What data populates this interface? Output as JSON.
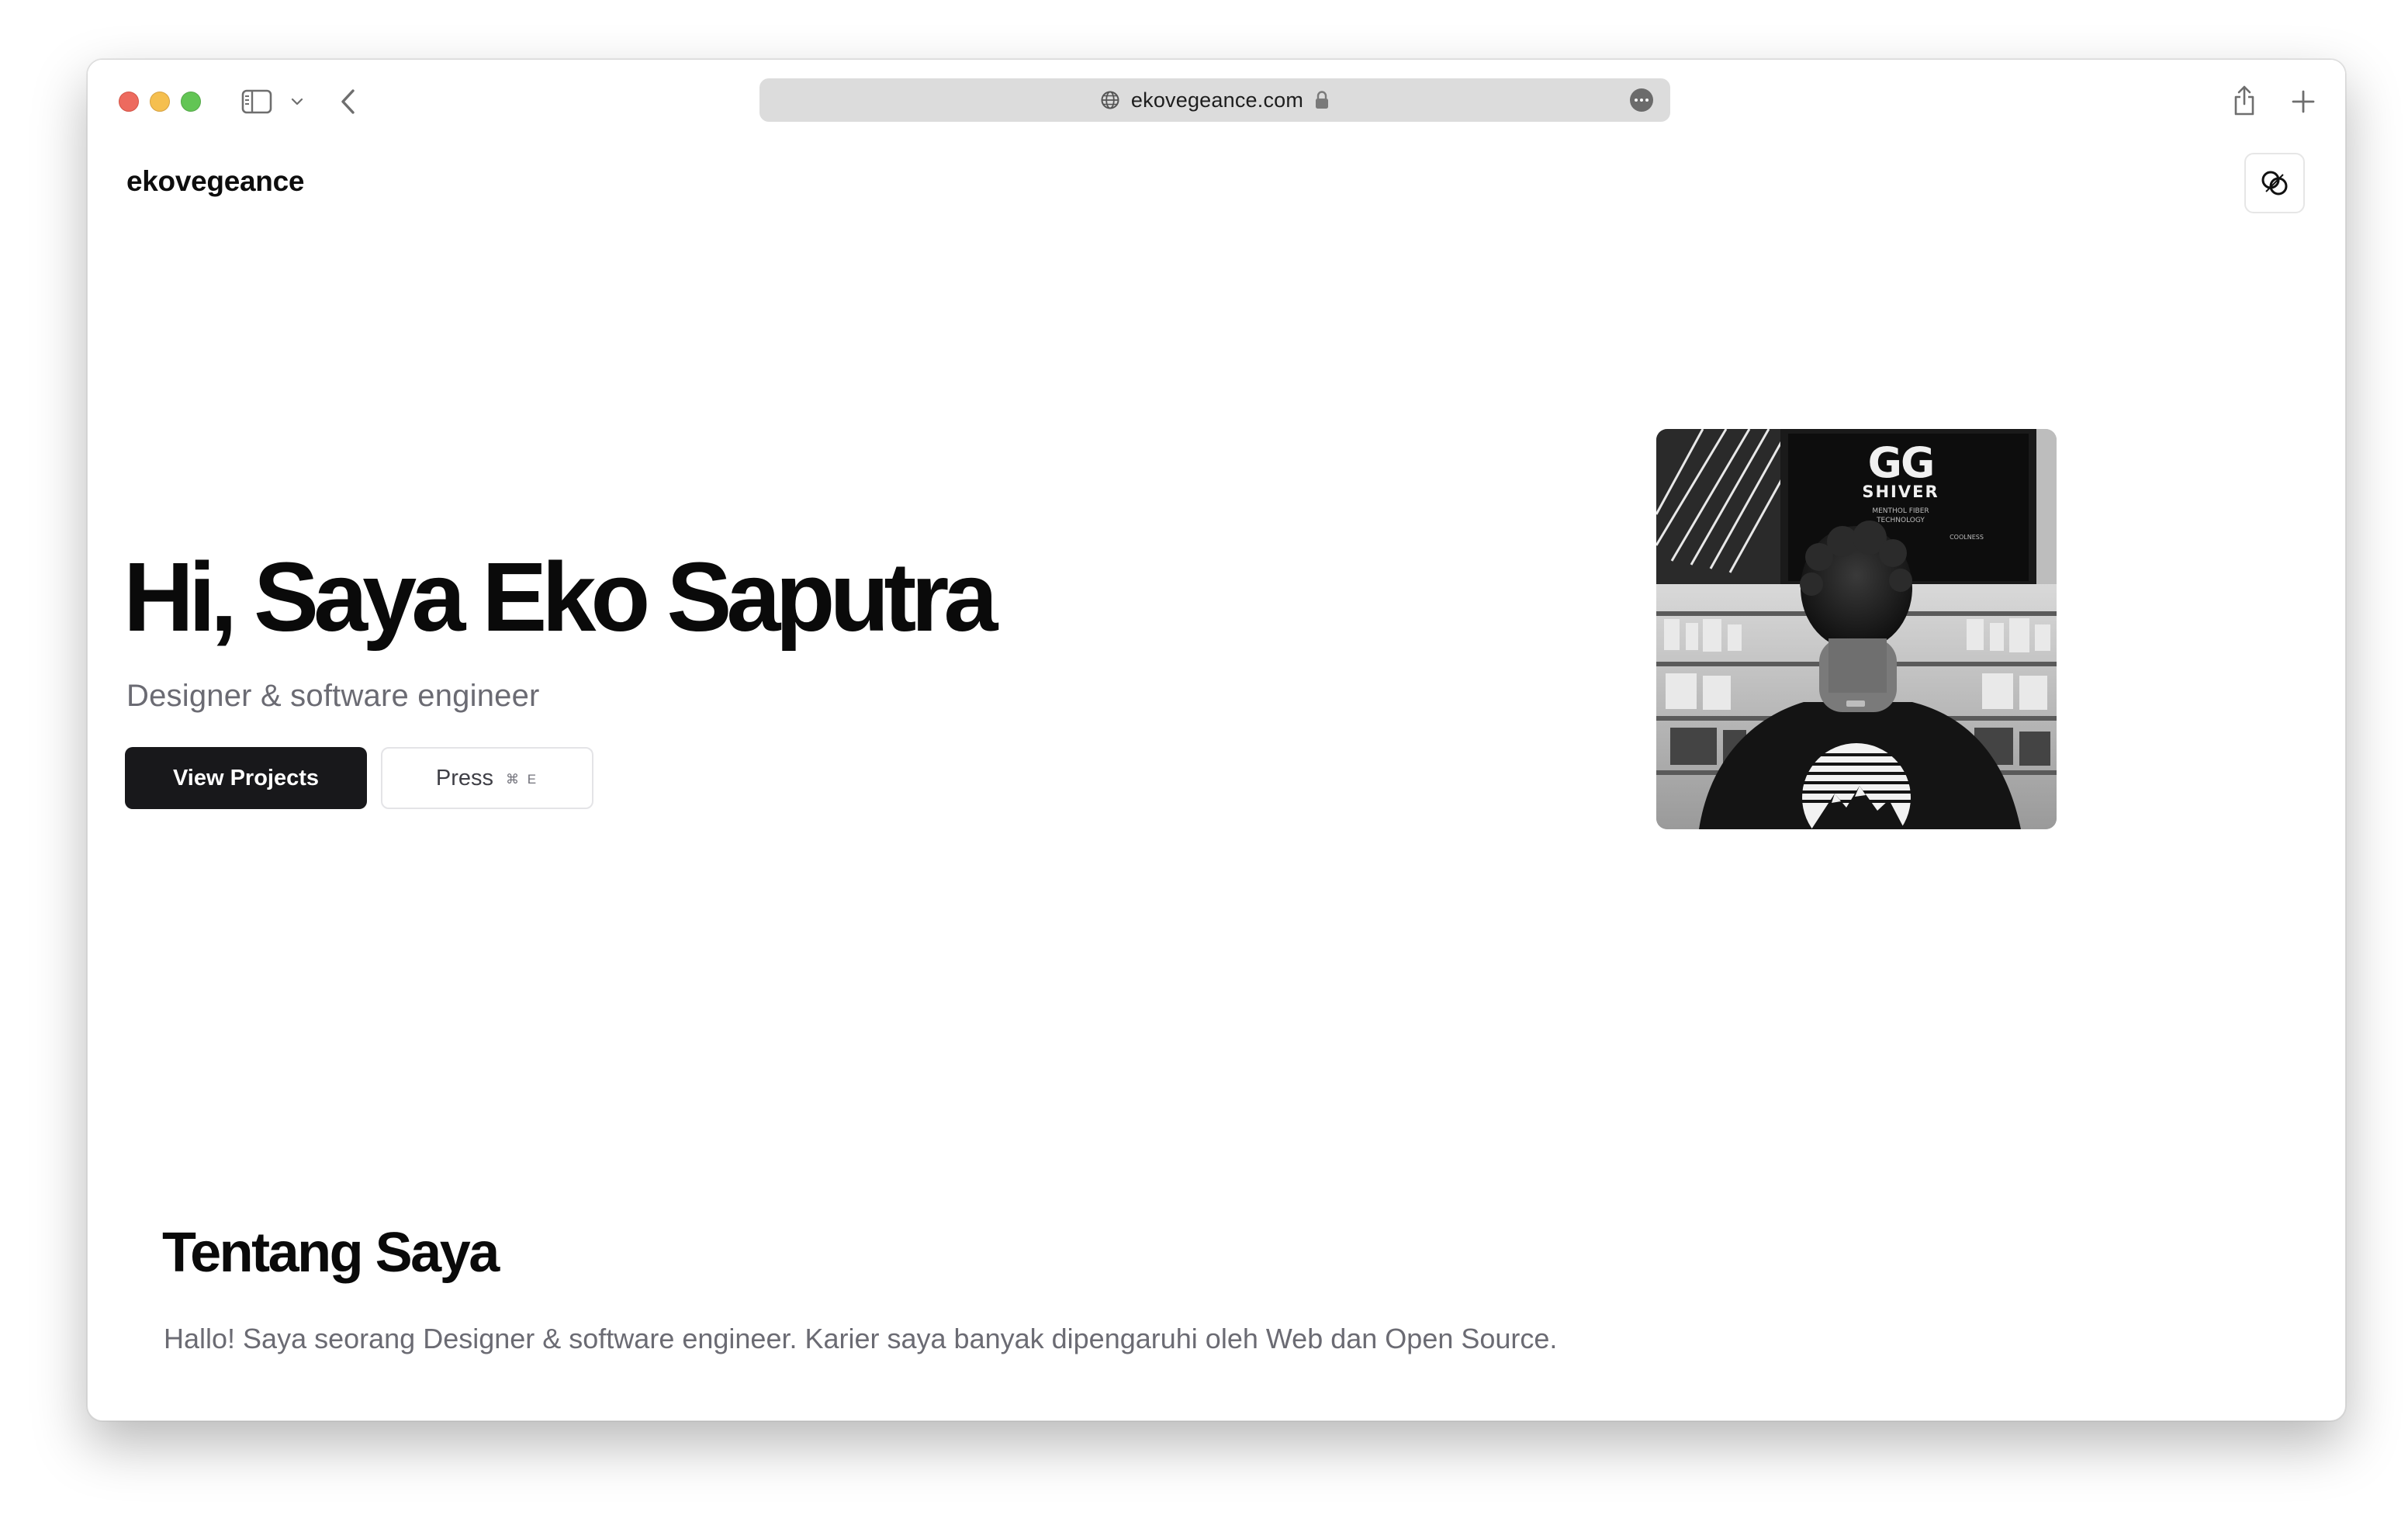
{
  "browser": {
    "url": "ekovegeance.com",
    "icons": {
      "sidebar": "sidebar-icon",
      "chevron": "chevron-down-icon",
      "back": "back-arrow-icon",
      "globe": "globe-icon",
      "lock": "lock-icon",
      "more": "more-icon",
      "share": "share-icon",
      "new_tab": "plus-icon"
    }
  },
  "site": {
    "logo": "ekovegeance",
    "theme_toggle_icon": "theme-toggle-icon"
  },
  "hero": {
    "title": "Hi, Saya Eko Saputra",
    "subtitle": "Designer & software engineer",
    "primary_button": "View Projects",
    "secondary_button": "Press",
    "shortcut": "⌘ E",
    "photo_text": {
      "brand": "GG",
      "product": "SHIVER",
      "line1": "MENTHOL FIBER",
      "line2": "TECHNOLOGY",
      "line3": "COOLNESS"
    }
  },
  "about": {
    "title": "Tentang Saya",
    "text": "Hallo! Saya seorang Designer & software engineer. Karier saya banyak dipengaruhi oleh Web dan Open Source."
  },
  "colors": {
    "primary_button_bg": "#18181b",
    "muted_text": "#6b6b73",
    "heading": "#0a0a0a"
  }
}
